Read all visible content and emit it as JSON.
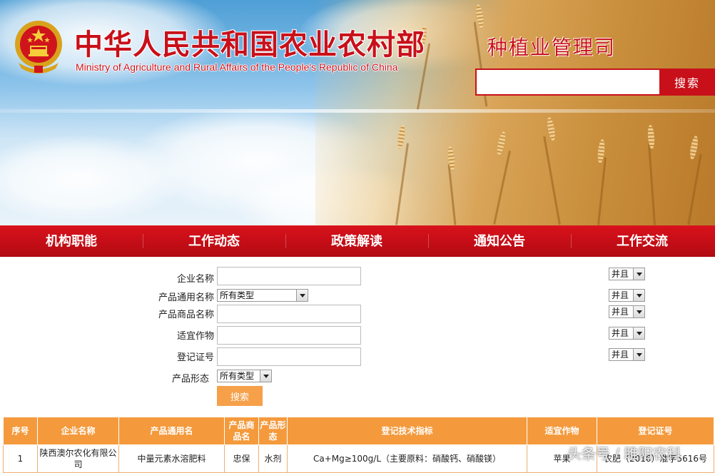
{
  "header": {
    "ministry_cn": "中华人民共和国农业农村部",
    "ministry_en": "Ministry of Agriculture and Rural Affairs of the People's Republic of China",
    "dept_name": "种植业管理司",
    "search_placeholder": "",
    "search_button": "搜索"
  },
  "nav": [
    "机构职能",
    "工作动态",
    "政策解读",
    "通知公告",
    "工作交流"
  ],
  "form": {
    "fields": [
      {
        "label": "企业名称",
        "type": "text",
        "value": "",
        "logic": "并且"
      },
      {
        "label": "产品通用名称",
        "type": "select",
        "value": "所有类型",
        "logic": "并且"
      },
      {
        "label": "产品商品名称",
        "type": "text",
        "value": "",
        "logic": "并且"
      },
      {
        "label": "适宜作物",
        "type": "text",
        "value": "",
        "logic": "并且"
      },
      {
        "label": "登记证号",
        "type": "text",
        "value": "",
        "logic": "并且"
      },
      {
        "label": "产品形态",
        "type": "select",
        "value": "所有类型"
      }
    ],
    "search_button": "搜索"
  },
  "table": {
    "headers": [
      "序号",
      "企业名称",
      "产品通用名",
      "产品商品名",
      "产品形态",
      "登记技术指标",
      "适宜作物",
      "登记证号"
    ],
    "rows": [
      [
        "1",
        "陕西澳尔农化有限公司",
        "中量元素水溶肥料",
        "忠保",
        "水剂",
        "Ca+Mg≥100g/L（主要原料：硝酸钙、硝酸镁）",
        "苹果",
        "农肥（2016）准字5616号"
      ]
    ]
  },
  "watermark": "头条号 / 雎阳农科",
  "colors": {
    "brand_red": "#c8101a",
    "accent_orange": "#f49a3c",
    "button_orange": "#f6a04a"
  }
}
